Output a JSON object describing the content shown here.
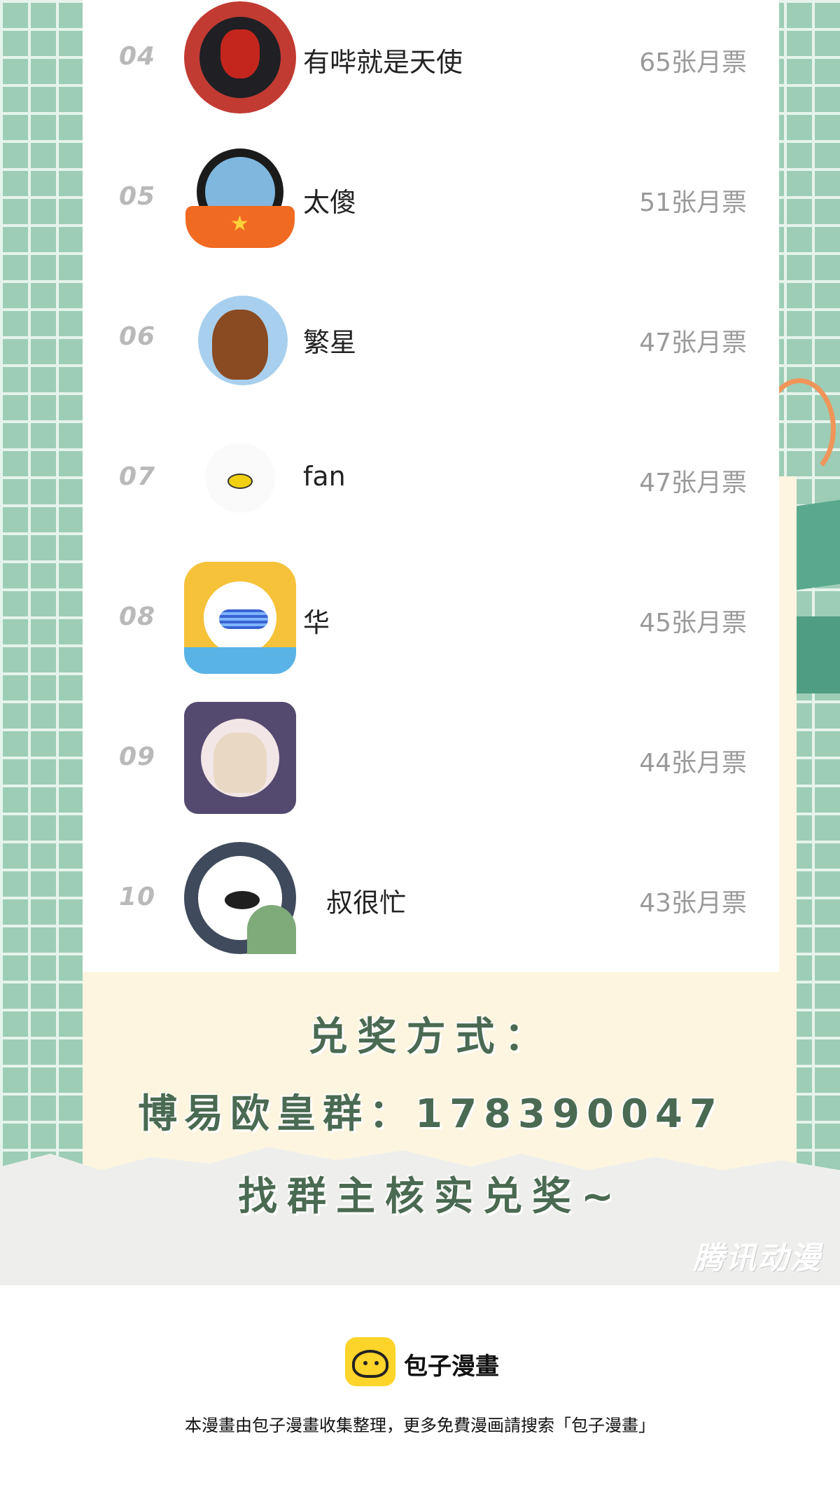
{
  "leaderboard": {
    "entries": [
      {
        "rank": "04",
        "name": "有哔就是天使",
        "votes": "65张月票",
        "avatar_icon": "deadpool-avatar-icon"
      },
      {
        "rank": "05",
        "name": "太傻",
        "votes": "51张月票",
        "avatar_icon": "anime-character-avatar-icon"
      },
      {
        "rank": "06",
        "name": "繁星",
        "votes": "47张月票",
        "avatar_icon": "bear-avatar-icon"
      },
      {
        "rank": "07",
        "name": "fan",
        "votes": "47张月票",
        "avatar_icon": "default-avatar-icon"
      },
      {
        "rank": "08",
        "name": "华",
        "votes": "45张月票",
        "avatar_icon": "star-frame-avatar-icon"
      },
      {
        "rank": "09",
        "name": "",
        "votes": "44张月票",
        "avatar_icon": "anime-girl-avatar-icon"
      },
      {
        "rank": "10",
        "name": "叔很忙",
        "votes": "43张月票",
        "avatar_icon": "cartoon-face-avatar-icon"
      }
    ]
  },
  "prize": {
    "title": "兑奖方式：",
    "group": "博易欧皇群：178390047",
    "note": "找群主核实兑奖~"
  },
  "watermark": "腾讯动漫",
  "footer": {
    "brand": "包子漫畫",
    "note": "本漫畫由包子漫畫收集整理，更多免費漫画請搜索「包子漫畫」",
    "logo_icon": "baozi-logo-icon"
  },
  "colors": {
    "grid_green": "#9dcdb6",
    "paper_cream": "#fdf5e0",
    "prize_text": "#4a6a52",
    "rank_gray": "#b9b9b9",
    "votes_gray": "#9a9a9a",
    "logo_yellow": "#fdd42a"
  }
}
